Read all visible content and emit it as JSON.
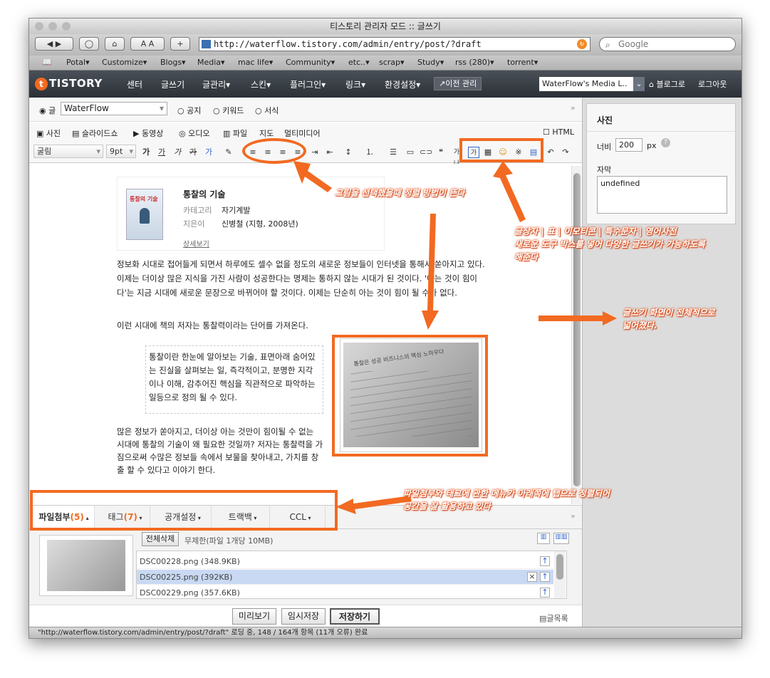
{
  "window": {
    "title": "티스토리 관리자 모드 :: 글쓰기"
  },
  "browser": {
    "url": "http://waterflow.tistory.com/admin/entry/post/?draft",
    "search_placeholder": "Google",
    "bookmarks": [
      "Potal▾",
      "Customize▾",
      "Blogs▾",
      "Media▾",
      "mac life▾",
      "Community▾",
      "etc..▾",
      "scrap▾",
      "Study▾",
      "rss (280)▾",
      "torrent▾"
    ],
    "status": "\"http://waterflow.tistory.com/admin/entry/post/?draft\" 로딩 중, 148 / 164개 항목 (11개 오류) 완료"
  },
  "tistory": {
    "logo": "TISTORY",
    "menu": [
      "센터",
      "글쓰기",
      "글관리▾",
      "스킨▾",
      "플러그인▾",
      "링크▾",
      "환경설정▾"
    ],
    "legacy": "↗이전 관리",
    "blog_select": "WaterFlow's Media L..",
    "blog_link": "블로그로",
    "logout": "로그아웃"
  },
  "editor": {
    "post_type": {
      "post": "글",
      "category": "WaterFlow",
      "notice": "공지",
      "keyword": "키워드",
      "form": "서식"
    },
    "media": [
      "사진",
      "슬라이드쇼",
      "동영상",
      "오디오",
      "파일",
      "지도",
      "멀티미디어"
    ],
    "html_label": "HTML",
    "font": "굴림",
    "size": "9pt",
    "book": {
      "title": "통찰의 기술",
      "category_label": "카테고리",
      "category": "자기계발",
      "author_label": "지은이",
      "author": "신병철 (지형, 2008년)",
      "more": "상세보기",
      "cover_text": "통찰의 기술"
    },
    "para1": "정보화 시대로 접어들게 되면서 하루에도 셀수 없을 정도의 새로운 정보들이 인터넷을 통해서 쏟아지고 있다. 이제는 더이상 많은 지식을 가진 사람이 성공한다는 명제는 통하지 않는 시대가 된 것이다. '아는 것이 힘이다'는 지금 시대에 새로운 문장으로 바뀌어야 할 것이다. 이제는 단순히 아는 것이 힘이 될 수가 없다.",
    "para2": "이런 시대에 책의 저자는 통찰력이라는 단어를 가져온다.",
    "quote": "통찰이란 한눈에 알아보는 기술, 표면아래 숨어있는 진실을 살펴보는 일, 즉각적이고, 분명한 지각이나 이해, 감추어진 핵심을 직관적으로 파악하는 일등으로 정의 될 수 있다.",
    "para3": "많은 정보가 쏟아지고, 더이상 아는 것만이 힘이될 수 없는 시대에 통찰의 기술이 왜 필요한 것일까? 저자는 통찰력을 가짐으로써 수많은 정보들 속에서 보물을 찾아내고, 가치를 창출 할 수 있다고 이야기 한다.",
    "photo_caption": "통찰은 성공 비즈니스의 핵심 노하우다"
  },
  "tabs": [
    {
      "label": "파일첨부",
      "count": "(5)"
    },
    {
      "label": "태그",
      "count": "(7)"
    },
    {
      "label": "공개설정",
      "count": ""
    },
    {
      "label": "트랙백",
      "count": ""
    },
    {
      "label": "CCL",
      "count": ""
    }
  ],
  "files": {
    "delete_all": "전체삭제",
    "limit": "무제한(파일 1개당 10MB)",
    "items": [
      "DSC00228.png (348.9KB)",
      "DSC00225.png (392KB)",
      "DSC00229.png (357.6KB)"
    ]
  },
  "actions": {
    "preview": "미리보기",
    "draft": "임시저장",
    "save": "저장하기",
    "list": "글목록"
  },
  "sidebar": {
    "title": "사진",
    "width_label": "너비",
    "width_value": "200",
    "unit": "px",
    "caption_label": "자막",
    "caption_value": "undefined"
  },
  "annotations": {
    "a1": "그림을 선택했을때 정렬 방법이 뜬다",
    "a2": "글상자 | 표 | 이모티콘 | 특수문자 | 영어사전\n새로운 도구 박스를 넣어 다양한 글쓰기가 가능하도록\n해준다",
    "a3": "글쓰기 화면이 전체적으로\n넓어졌다.",
    "a4": "파일첨부와 태그에 관한 메뉴가 아래쪽에 탭으로 정렬되어\n공간을 잘 활용하고 있다"
  },
  "colors": {
    "accent": "#f26a21",
    "nav_dark": "#33383e",
    "selected_row": "#c9d9f3"
  }
}
